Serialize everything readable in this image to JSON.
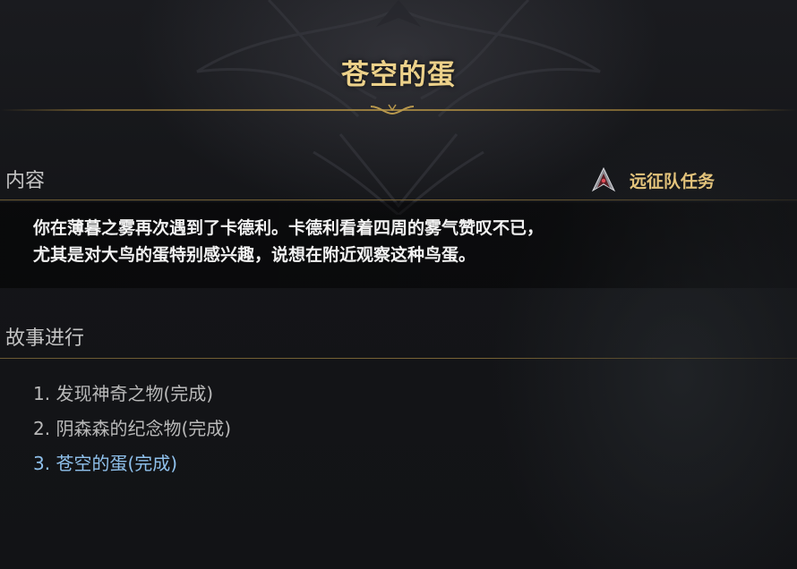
{
  "quest": {
    "title": "苍空的蛋",
    "type_label": "远征队任务",
    "type_icon": "expedition-quest-icon"
  },
  "sections": {
    "content_header": "内容",
    "story_header": "故事进行"
  },
  "description": {
    "line1": "你在薄暮之雾再次遇到了卡德利。卡德利看着四周的雾气赞叹不已，",
    "line2": "尤其是对大鸟的蛋特别感兴趣，说想在附近观察这种鸟蛋。"
  },
  "story_steps": [
    {
      "label": "1. 发现神奇之物(完成)",
      "current": false
    },
    {
      "label": "2. 阴森森的纪念物(完成)",
      "current": false
    },
    {
      "label": "3. 苍空的蛋(完成)",
      "current": true
    }
  ],
  "colors": {
    "title_gold": "#ecd18a",
    "type_gold": "#e3c37b",
    "current_step_blue": "#8fc1ec",
    "done_step_gray": "#b9b9b9"
  }
}
